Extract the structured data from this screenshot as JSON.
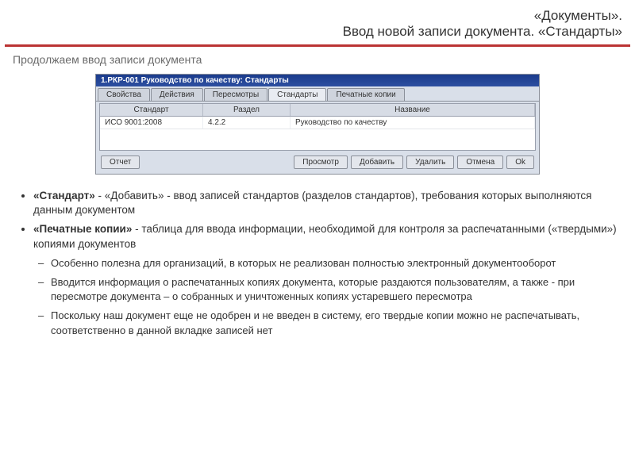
{
  "header": {
    "line1": "«Документы».",
    "line2": "Ввод новой записи документа. «Стандарты»"
  },
  "intro": "Продолжаем ввод записи документа",
  "app": {
    "title": "1.РКР-001 Руководство по качеству: Стандарты",
    "tabs": [
      "Свойства",
      "Действия",
      "Пересмотры",
      "Стандарты",
      "Печатные копии"
    ],
    "active_tab_index": 3,
    "columns": [
      "Стандарт",
      "Раздел",
      "Название"
    ],
    "rows": [
      {
        "c1": "ИСО 9001:2008",
        "c2": "4.2.2",
        "c3": "Руководство по качеству"
      }
    ],
    "buttons": {
      "left": "Отчет",
      "right": [
        "Просмотр",
        "Добавить",
        "Удалить",
        "Отмена",
        "Ok"
      ]
    }
  },
  "bullets": {
    "b1_strong": "«Стандарт»",
    "b1_rest": " - «Добавить» - ввод записей стандартов (разделов стандартов), требования которых выполняются данным документом",
    "b2_strong": "«Печатные копии»",
    "b2_rest": " - таблица для ввода информации, необходимой для контроля за распечатанными («твердыми») копиями документов",
    "sub": [
      "Особенно полезна для организаций, в которых не реализован полностью электронный документооборот",
      "Вводится информация о распечатанных копиях документа, которые раздаются пользователям, а также  - при пересмотре документа – о собранных и уничтоженных копиях устаревшего пересмотра",
      "Поскольку наш документ еще не одобрен и не введен в систему, его твердые копии можно не распечатывать, соответственно в данной вкладке записей нет"
    ]
  }
}
